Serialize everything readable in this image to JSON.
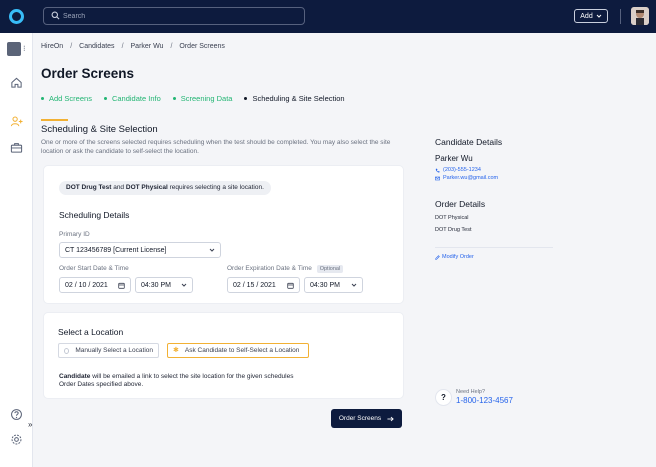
{
  "topbar": {
    "search_placeholder": "Search",
    "add_label": "Add"
  },
  "breadcrumb": [
    "HireOn",
    "Candidates",
    "Parker Wu",
    "Order Screens"
  ],
  "page_title": "Order Screens",
  "steps": [
    {
      "label": "Add Screens",
      "status": "done"
    },
    {
      "label": "Candidate Info",
      "status": "done"
    },
    {
      "label": "Screening Data",
      "status": "done"
    },
    {
      "label": "Scheduling & Site Selection",
      "status": "current"
    }
  ],
  "section": {
    "title": "Scheduling & Site Selection",
    "description": "One or more of the screens selected requires scheduling when the test should be completed. You may also select the site location or ask the candidate to self-select the location."
  },
  "notice": {
    "test1": "DOT Drug Test",
    "and": "and",
    "test2": "DOT Physical",
    "rest": "requires selecting a site location."
  },
  "scheduling": {
    "title": "Scheduling Details",
    "primary_id_label": "Primary ID",
    "primary_id_value": "CT 123456789 [Current License]",
    "start_label": "Order Start Date & Time",
    "start_date": "02 / 10 / 2021",
    "start_time": "04:30 PM",
    "expiration_label": "Order Expiration Date & Time",
    "optional_badge": "Optional",
    "expiration_date": "02 / 15 / 2021",
    "expiration_time": "04:30 PM"
  },
  "location": {
    "title": "Select a Location",
    "option_manual": "Manually Select a Location",
    "option_self": "Ask Candidate to Self-Select a Location",
    "selected": "self",
    "note_bold": "Candidate",
    "note_line1": "will be emailed a link to select the site location for the given schedules",
    "note_line2": "Order Dates specified above."
  },
  "submit_label": "Order Screens",
  "candidate": {
    "heading": "Candidate Details",
    "name": "Parker Wu",
    "phone": "(203)-555-1234",
    "email": "Parker.wu@gmail.com"
  },
  "order": {
    "heading": "Order Details",
    "items": [
      "DOT Physical",
      "DOT Drug Test"
    ],
    "modify_label": "Modify Order"
  },
  "help": {
    "label": "Need Help?",
    "phone": "1-800-123-4567"
  },
  "colors": {
    "navy": "#0d1b3e",
    "success": "#22b573",
    "accent": "#f2b134",
    "link": "#2563eb"
  }
}
